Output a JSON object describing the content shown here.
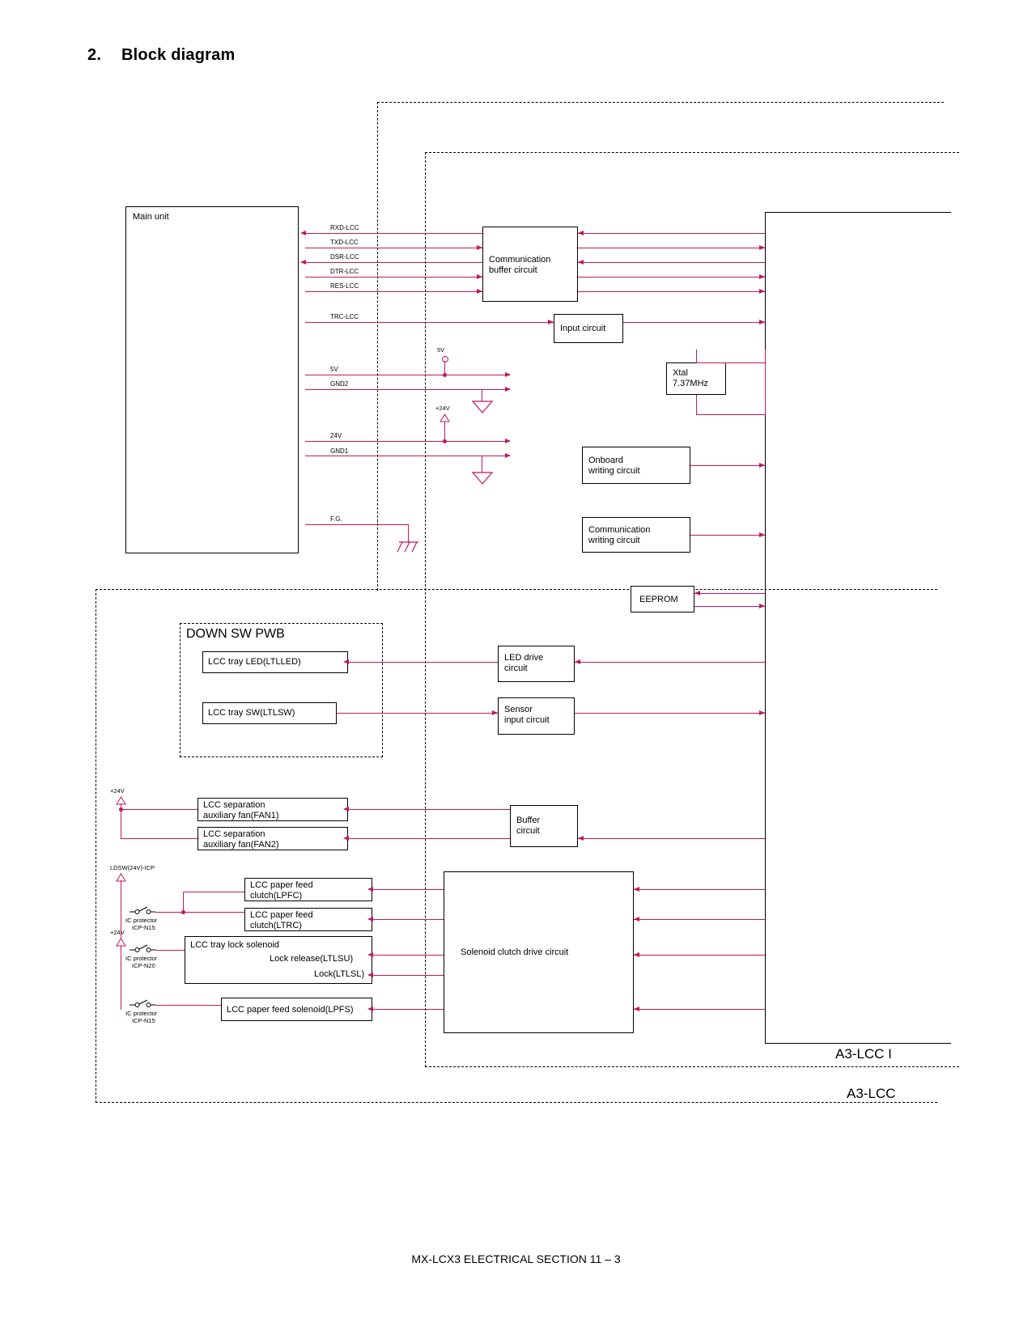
{
  "page": {
    "title_number": "2.",
    "title_text": "Block diagram",
    "footer": "MX-LCX3  ELECTRICAL SECTION  11 – 3"
  },
  "regions": {
    "down_sw_pwb": "DOWN SW PWB",
    "a3_lcc_pwb": "A3-LCC I",
    "a3_lcc": "A3-LCC"
  },
  "blocks": {
    "main_unit": "Main unit",
    "communication_buffer": "Communication\nbuffer circuit",
    "input_circuit": "Input circuit",
    "xtal": "Xtal\n7.37MHz",
    "onboard_writing": "Onboard\nwriting circuit",
    "communication_writing": "Communication\nwriting circuit",
    "eeprom": "EEPROM",
    "lcc_tray_led": "LCC tray LED(LTLLED)",
    "lcc_tray_sw": "LCC tray SW(LTLSW)",
    "led_drive": "LED drive\ncircuit",
    "sensor_input": "Sensor\ninput circuit",
    "fan1": "LCC separation\nauxiliary fan(FAN1)",
    "fan2": "LCC separation\nauxiliary fan(FAN2)",
    "buffer_circuit": "Buffer\ncircuit",
    "clutch_lpfc": "LCC paper feed\nclutch(LPFC)",
    "clutch_ltrc": "LCC paper feed\nclutch(LTRC)",
    "tray_lock_solenoid": "LCC tray lock solenoid",
    "lock_release": "Lock release(LTLSU)",
    "lock": "Lock(LTLSL)",
    "feed_solenoid": "LCC paper feed solenoid(LPFS)",
    "solenoid_clutch_drive": "Solenoid clutch drive circuit"
  },
  "signals": {
    "rxd": "RXD-LCC",
    "txd": "TXD-LCC",
    "dsr": "DSR-LCC",
    "dtr": "DTR-LCC",
    "res": "RES-LCC",
    "trc": "TRC-LCC",
    "v5": "5V",
    "gnd2": "GND2",
    "v24": "24V",
    "gnd1": "GND1",
    "fg": "F.G."
  },
  "annotations": {
    "rail_5v": "5V",
    "rail_24v_top": "+24V",
    "rail_24v_fan": "+24V",
    "ldsw": "LDSW(24V)-ICP",
    "icp1_label": "IC protector",
    "icp1_value": "ICP-N15",
    "rail_24v_sol": "+24V",
    "icp2_label": "IC protector",
    "icp2_value": "ICP-N20",
    "icp3_label": "IC protector",
    "icp3_value": "ICP-N15"
  },
  "colors": {
    "wire": "#c2185b",
    "outline": "#000000"
  }
}
